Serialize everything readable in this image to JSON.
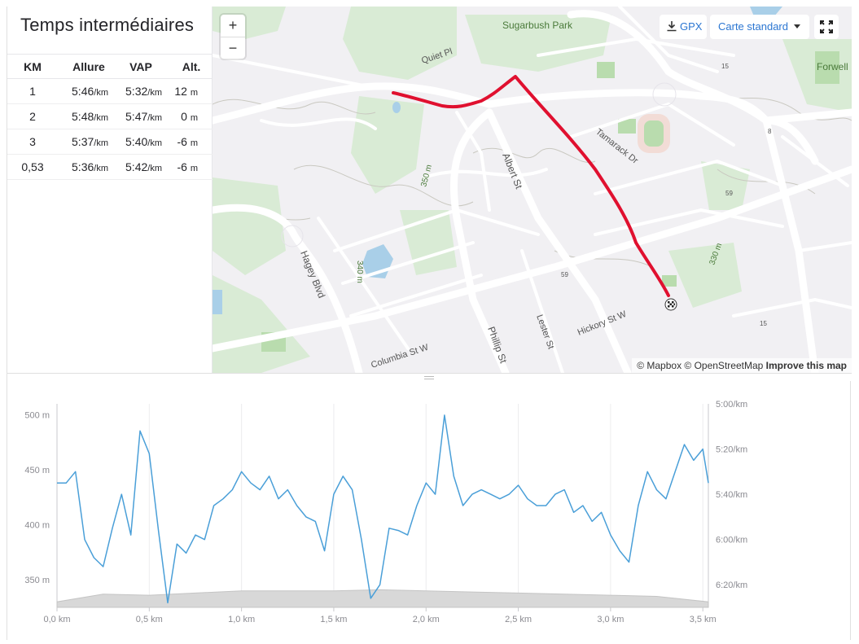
{
  "splits": {
    "title": "Temps intermédiaires",
    "headers": [
      "KM",
      "Allure",
      "VAP",
      "Alt."
    ],
    "rows": [
      {
        "km": "1",
        "pace": "5:46",
        "gap": "5:32",
        "elev": "12",
        "elev_unit": "m"
      },
      {
        "km": "2",
        "pace": "5:48",
        "gap": "5:47",
        "elev": "0",
        "elev_unit": "m"
      },
      {
        "km": "3",
        "pace": "5:37",
        "gap": "5:40",
        "elev": "-6",
        "elev_unit": "m"
      },
      {
        "km": "0,53",
        "pace": "5:36",
        "gap": "5:42",
        "elev": "-6",
        "elev_unit": "m"
      }
    ],
    "pace_unit": "/km"
  },
  "map": {
    "zoom_in": "+",
    "zoom_out": "−",
    "gpx_label": "GPX",
    "style_label": "Carte standard",
    "attribution": "© Mapbox © OpenStreetMap",
    "improve": "Improve this map",
    "route_color": "#e0102f",
    "labels": {
      "park": "Sugarbush Park",
      "quiet": "Quiet Pl",
      "forwell": "Forwell",
      "albert": "Albert St",
      "tamarack": "Tamarack Dr",
      "hagey": "Hagey Blvd",
      "phillip": "Phillip St",
      "lester": "Lester St",
      "hickory": "Hickory St W",
      "columbia": "Columbia St W",
      "c350": "350 m",
      "c340": "340 m",
      "c330": "330 m",
      "r59a": "59",
      "r59b": "59",
      "r15a": "15",
      "r15b": "15",
      "r8": "8"
    }
  },
  "chart_data": {
    "type": "line",
    "x_unit": "km",
    "xlim": [
      0,
      3.53
    ],
    "x_ticks": [
      "0,0 km",
      "0,5 km",
      "1,0 km",
      "1,5 km",
      "2,0 km",
      "2,5 km",
      "3,0 km",
      "3,5 km"
    ],
    "left_axis": {
      "label": "",
      "ticks": [
        "500 m",
        "450 m",
        "400 m",
        "350 m"
      ]
    },
    "right_axis": {
      "label": "",
      "ticks": [
        "5:00/km",
        "5:20/km",
        "5:40/km",
        "6:00/km",
        "6:20/km"
      ],
      "pace_range_sec": [
        300,
        390
      ]
    },
    "pace_color": "#4a9fd8",
    "elev_color": "#d8d8d8",
    "pace_series": {
      "name": "",
      "x": [
        0,
        0.05,
        0.1,
        0.15,
        0.2,
        0.25,
        0.3,
        0.35,
        0.4,
        0.45,
        0.5,
        0.55,
        0.6,
        0.65,
        0.7,
        0.75,
        0.8,
        0.85,
        0.9,
        0.95,
        1.0,
        1.05,
        1.1,
        1.15,
        1.2,
        1.25,
        1.3,
        1.35,
        1.4,
        1.45,
        1.5,
        1.55,
        1.6,
        1.65,
        1.7,
        1.75,
        1.8,
        1.85,
        1.9,
        1.95,
        2.0,
        2.05,
        2.1,
        2.15,
        2.2,
        2.25,
        2.3,
        2.35,
        2.4,
        2.45,
        2.5,
        2.55,
        2.6,
        2.65,
        2.7,
        2.75,
        2.8,
        2.85,
        2.9,
        2.95,
        3.0,
        3.05,
        3.1,
        3.15,
        3.2,
        3.25,
        3.3,
        3.35,
        3.4,
        3.45,
        3.5,
        3.53
      ],
      "pace_sec": [
        335,
        335,
        330,
        360,
        368,
        372,
        355,
        340,
        358,
        312,
        322,
        356,
        388,
        362,
        366,
        358,
        360,
        345,
        342,
        338,
        330,
        335,
        338,
        332,
        342,
        338,
        345,
        350,
        352,
        365,
        340,
        332,
        338,
        360,
        386,
        380,
        355,
        356,
        358,
        345,
        335,
        340,
        305,
        332,
        345,
        340,
        338,
        340,
        342,
        340,
        336,
        342,
        345,
        345,
        340,
        338,
        348,
        345,
        352,
        348,
        358,
        365,
        370,
        345,
        330,
        338,
        342,
        330,
        318,
        325,
        320,
        335
      ]
    },
    "elevation_series": {
      "name": "",
      "x": [
        0,
        0.25,
        0.5,
        0.75,
        1.0,
        1.25,
        1.5,
        1.75,
        2.0,
        2.25,
        2.5,
        2.75,
        3.0,
        3.25,
        3.53
      ],
      "elev": [
        330,
        337,
        336,
        338,
        340,
        340,
        340,
        341,
        340,
        339,
        338,
        337,
        336,
        335,
        330
      ]
    }
  }
}
